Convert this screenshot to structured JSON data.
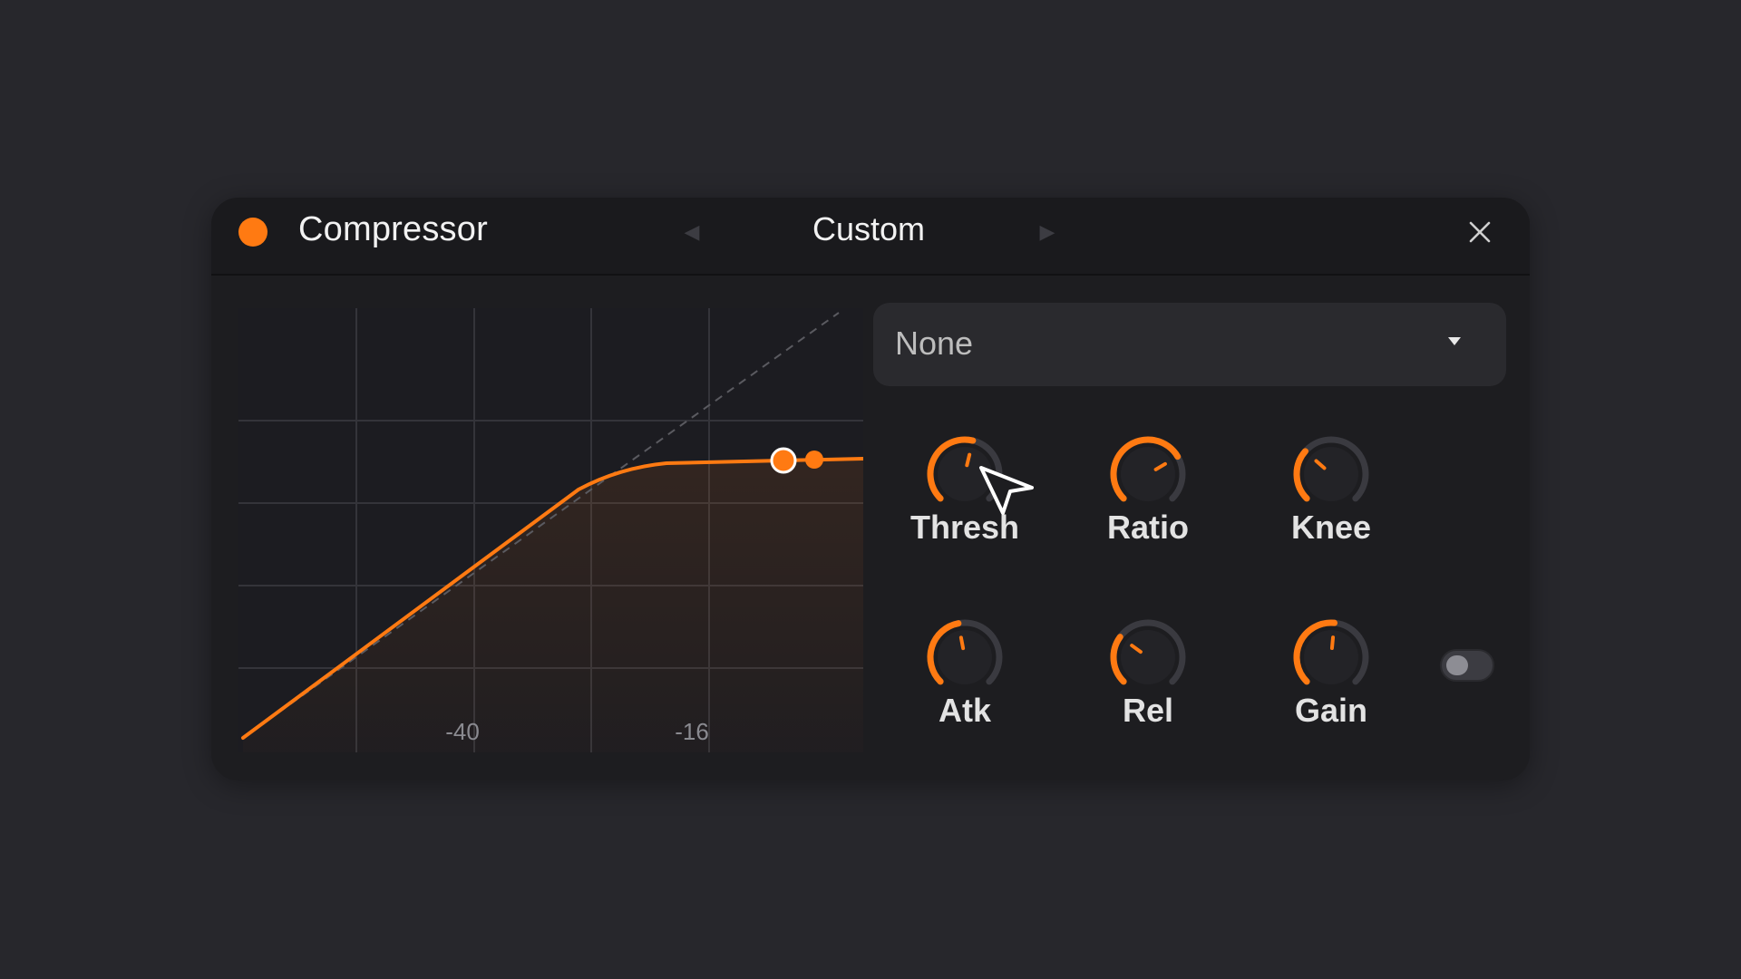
{
  "header": {
    "title": "Compressor",
    "preset_name": "Custom"
  },
  "graph": {
    "x_tick_labels": [
      "-40",
      "-16"
    ]
  },
  "sidechain": {
    "selected": "None"
  },
  "knobs": [
    {
      "label": "Thresh",
      "value": 0.55
    },
    {
      "label": "Ratio",
      "value": 0.72
    },
    {
      "label": "Knee",
      "value": 0.32
    },
    {
      "label": "Atk",
      "value": 0.46
    },
    {
      "label": "Rel",
      "value": 0.3
    },
    {
      "label": "Gain",
      "value": 0.52
    }
  ],
  "colors": {
    "accent": "#ff7a12",
    "panel": "#1d1d20",
    "background": "#27272c",
    "track": "#3a3a40"
  },
  "icons": {
    "power": "power-dot-icon",
    "prev": "chevron-left-icon",
    "next": "chevron-right-icon",
    "close": "close-icon",
    "dropdown": "caret-down-icon",
    "cursor": "mouse-pointer-icon"
  },
  "toggle": {
    "on": false
  }
}
